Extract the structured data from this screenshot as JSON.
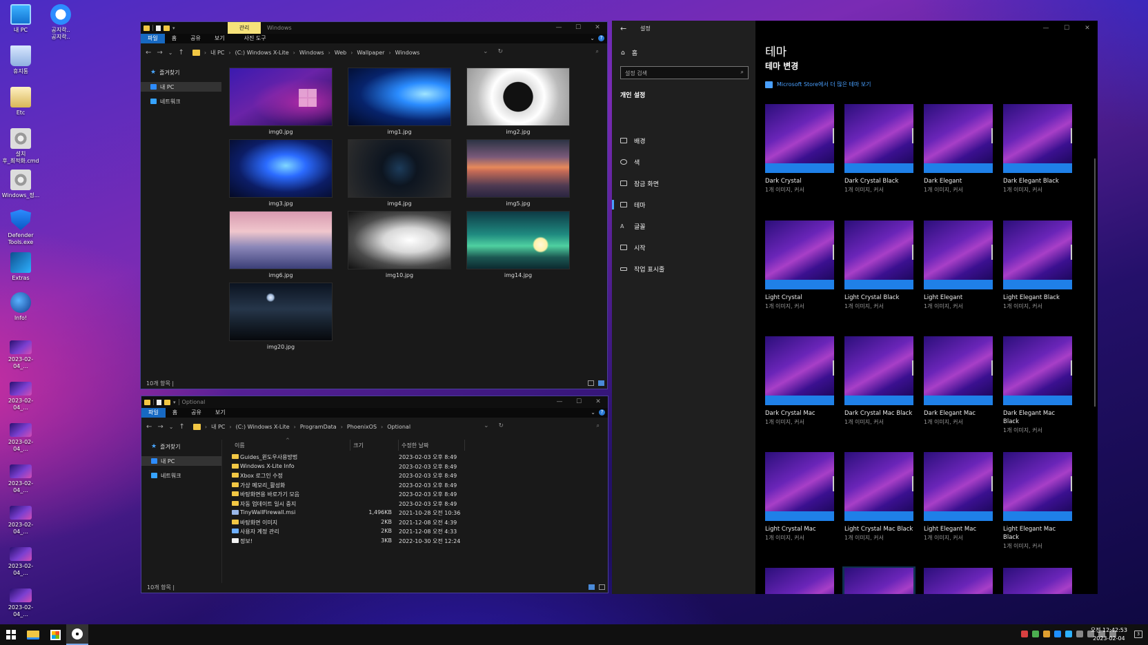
{
  "desktop": {
    "icons": [
      {
        "label": "내 PC",
        "icon": "computer-icon"
      },
      {
        "label": "공지락..\n공지락..",
        "icon": "internet-explorer-icon"
      },
      {
        "label": "휴지통",
        "icon": "recycle-bin-icon"
      },
      {
        "label": "Etc",
        "icon": "folder-icon"
      },
      {
        "label": "설치\n후_최적화.cmd",
        "icon": "gear-script-icon"
      },
      {
        "label": "Windows_정...",
        "icon": "gear-script-icon"
      },
      {
        "label": "Defender\nTools.exe",
        "icon": "shield-icon"
      },
      {
        "label": "Extras",
        "icon": "extras-icon"
      },
      {
        "label": "Info!",
        "icon": "globe-icon"
      },
      {
        "label": "2023-02-04_...",
        "icon": "screenshot-thumb-icon"
      },
      {
        "label": "2023-02-04_...",
        "icon": "screenshot-thumb-icon"
      },
      {
        "label": "2023-02-04_...",
        "icon": "screenshot-thumb-icon"
      },
      {
        "label": "2023-02-04_...",
        "icon": "screenshot-thumb-icon"
      },
      {
        "label": "2023-02-04_...",
        "icon": "screenshot-thumb-icon"
      },
      {
        "label": "2023-02-04_...",
        "icon": "screenshot-thumb-icon"
      },
      {
        "label": "2023-02-04_...",
        "icon": "screenshot-thumb-icon"
      }
    ]
  },
  "explorer1": {
    "context_tab": "관리",
    "title": "Windows",
    "ribbon_tabs": [
      "파일",
      "홈",
      "공유",
      "보기",
      "사진 도구"
    ],
    "breadcrumb": [
      "내 PC",
      "(C:) Windows X-Lite",
      "Windows",
      "Web",
      "Wallpaper",
      "Windows"
    ],
    "nav": [
      "즐겨찾기",
      "내 PC",
      "네트워크"
    ],
    "files": [
      "img0.jpg",
      "img1.jpg",
      "img2.jpg",
      "img3.jpg",
      "img4.jpg",
      "img5.jpg",
      "img6.jpg",
      "img10.jpg",
      "img14.jpg",
      "img20.jpg"
    ],
    "status": "10개 항목  |"
  },
  "explorer2": {
    "title": "Optional",
    "ribbon_tabs": [
      "파일",
      "홈",
      "공유",
      "보기"
    ],
    "breadcrumb": [
      "내 PC",
      "(C:) Windows X-Lite",
      "ProgramData",
      "PhoenixOS",
      "Optional"
    ],
    "nav": [
      "즐겨찾기",
      "내 PC",
      "네트워크"
    ],
    "columns": [
      "이름",
      "크기",
      "수정한 날짜"
    ],
    "rows": [
      {
        "name": "Guides_윈도우사용방법",
        "size": "",
        "date": "2023-02-03 오후 8:49",
        "type": "folder"
      },
      {
        "name": "Windows X-Lite Info",
        "size": "",
        "date": "2023-02-03 오후 8:49",
        "type": "folder"
      },
      {
        "name": "Xbox 로그인 수정",
        "size": "",
        "date": "2023-02-03 오후 8:49",
        "type": "folder"
      },
      {
        "name": "가상 메모리_활성화",
        "size": "",
        "date": "2023-02-03 오후 8:49",
        "type": "folder"
      },
      {
        "name": "바탕화면용 바로가기 모음",
        "size": "",
        "date": "2023-02-03 오후 8:49",
        "type": "folder"
      },
      {
        "name": "자동 업데이트 일시 중지",
        "size": "",
        "date": "2023-02-03 오후 8:49",
        "type": "folder"
      },
      {
        "name": "TinyWallFirewall.msi",
        "size": "1,496KB",
        "date": "2021-10-28 오전 10:36",
        "type": "msi"
      },
      {
        "name": "바탕화면 이미지",
        "size": "2KB",
        "date": "2021-12-08 오전 4:39",
        "type": "folder"
      },
      {
        "name": "사용자 계정 관리",
        "size": "2KB",
        "date": "2021-12-08 오전 4:33",
        "type": "lnk"
      },
      {
        "name": "정보!",
        "size": "3KB",
        "date": "2022-10-30 오전 12:24",
        "type": "txt"
      }
    ],
    "status": "10개 항목  |"
  },
  "settings": {
    "app_title": "설정",
    "home": "홈",
    "search_placeholder": "설정 검색",
    "section": "개인 설정",
    "nav": [
      "배경",
      "색",
      "잠금 화면",
      "테마",
      "글꼴",
      "시작",
      "작업 표시줄"
    ],
    "selected_nav": "테마",
    "heading": "테마",
    "subheading": "테마 변경",
    "store_link": "Microsoft Store에서 더 많은 테마 보기",
    "themes": [
      {
        "name": "Dark Crystal",
        "sub": "1개 이미지, 커서"
      },
      {
        "name": "Dark Crystal Black",
        "sub": "1개 이미지, 커서"
      },
      {
        "name": "Dark Elegant",
        "sub": "1개 이미지, 커서"
      },
      {
        "name": "Dark Elegant Black",
        "sub": "1개 이미지, 커서"
      },
      {
        "name": "Light Crystal",
        "sub": "1개 이미지, 커서"
      },
      {
        "name": "Light Crystal Black",
        "sub": "1개 이미지, 커서"
      },
      {
        "name": "Light Elegant",
        "sub": "1개 이미지, 커서"
      },
      {
        "name": "Light Elegant Black",
        "sub": "1개 이미지, 커서"
      },
      {
        "name": "Dark Crystal Mac",
        "sub": "1개 이미지, 커서"
      },
      {
        "name": "Dark Crystal Mac Black",
        "sub": "1개 이미지, 커서"
      },
      {
        "name": "Dark Elegant Mac",
        "sub": "1개 이미지, 커서"
      },
      {
        "name": "Dark Elegant Mac Black",
        "sub": "1개 이미지, 커서"
      },
      {
        "name": "Light Crystal Mac",
        "sub": "1개 이미지, 커서"
      },
      {
        "name": "Light Crystal Mac Black",
        "sub": "1개 이미지, 커서"
      },
      {
        "name": "Light Elegant Mac",
        "sub": "1개 이미지, 커서"
      },
      {
        "name": "Light Elegant Mac\nBlack",
        "sub": "1개 이미지, 커서"
      },
      {
        "name": "",
        "sub": ""
      },
      {
        "name": "",
        "sub": ""
      },
      {
        "name": "",
        "sub": ""
      },
      {
        "name": "",
        "sub": ""
      }
    ]
  },
  "taskbar": {
    "clock_time": "오전 12:42:53",
    "clock_date": "2023-02-04",
    "notification_count": "3"
  },
  "colors": {
    "accent": "#1f80e8",
    "link": "#4aa0ff",
    "ribbon_active": "#1769c2",
    "context_tab": "#f6e27a"
  }
}
